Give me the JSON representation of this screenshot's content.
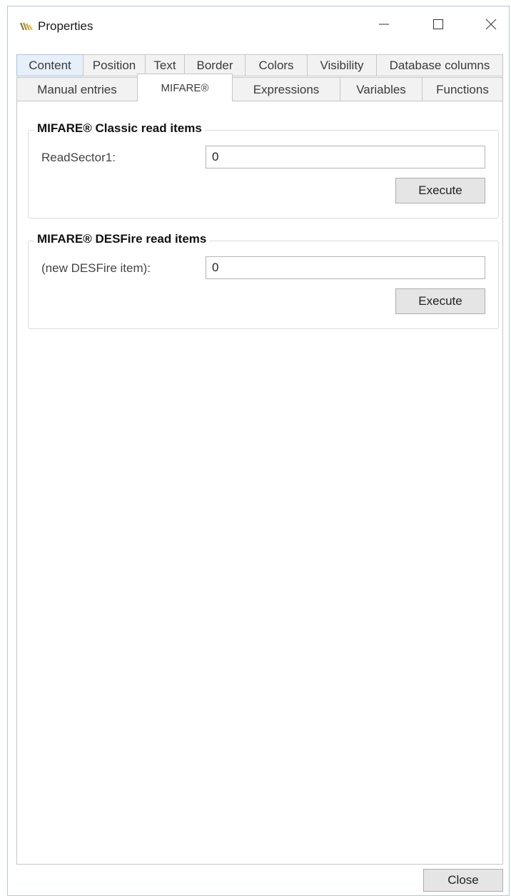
{
  "window": {
    "title": "Properties",
    "controls": {
      "minimize": "minimize-icon",
      "maximize": "maximize-icon",
      "close": "close-icon"
    }
  },
  "tabs": {
    "row1": [
      "Content",
      "Position",
      "Text",
      "Border",
      "Colors",
      "Visibility",
      "Database columns"
    ],
    "row2": [
      "Manual entries",
      "MIFARE®",
      "Expressions",
      "Variables",
      "Functions"
    ],
    "active": "MIFARE®"
  },
  "mifare": {
    "classic": {
      "title": "MIFARE® Classic read items",
      "label": "ReadSector1:",
      "value": "0",
      "execute_label": "Execute"
    },
    "desfire": {
      "title": "MIFARE® DESFire read items",
      "label": "(new DESFire item):",
      "value": "0",
      "execute_label": "Execute"
    }
  },
  "footer": {
    "close_label": "Close"
  },
  "colors": {
    "accent_tab": "#e6effa",
    "button_bg": "#e5e5e5",
    "border": "#c6c6c6"
  }
}
